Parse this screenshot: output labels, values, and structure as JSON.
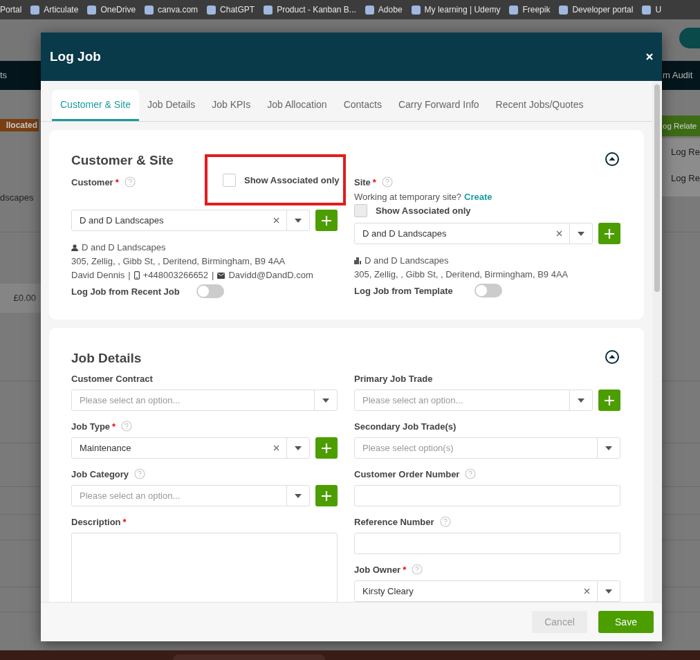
{
  "bookmarks": [
    {
      "label": "Portal",
      "icon": false
    },
    {
      "label": "Articulate",
      "icon": true
    },
    {
      "label": "OneDrive",
      "icon": true
    },
    {
      "label": "canva.com",
      "icon": true
    },
    {
      "label": "ChatGPT",
      "icon": true
    },
    {
      "label": "Product - Kanban B...",
      "icon": true
    },
    {
      "label": "Adobe",
      "icon": true
    },
    {
      "label": "My learning | Udemy",
      "icon": true
    },
    {
      "label": "Freepik",
      "icon": true
    },
    {
      "label": "Developer portal",
      "icon": true
    },
    {
      "label": "U",
      "icon": true
    }
  ],
  "background": {
    "nav_left": "ts",
    "nav_right": "m Audit",
    "status_badge": "llocated",
    "customer_text": "dscapes",
    "amount": "£0.00",
    "action_button": "og Relate",
    "menu_items": [
      "Log Re",
      "Log Re"
    ]
  },
  "dialog": {
    "title": "Log Job",
    "tabs": [
      {
        "label": "Customer & Site",
        "selected": true
      },
      {
        "label": "Job Details",
        "selected": false
      },
      {
        "label": "Job KPIs",
        "selected": false
      },
      {
        "label": "Job Allocation",
        "selected": false
      },
      {
        "label": "Contacts",
        "selected": false
      },
      {
        "label": "Carry Forward Info",
        "selected": false
      },
      {
        "label": "Recent Jobs/Quotes",
        "selected": false
      }
    ],
    "customer_site": {
      "title": "Customer & Site",
      "customer": {
        "label": "Customer",
        "required_mark": "*",
        "help": true,
        "associated": {
          "label": "Show Associated only",
          "checked": false,
          "disabled": false,
          "highlighted": true
        },
        "select": {
          "kind": "select",
          "value": "D and D Landscapes",
          "clearable": true,
          "add_button": true
        },
        "name": "D and D Landscapes",
        "address": "305, Zellig, , Gibb St, , Deritend, Birmingham, B9 4AA",
        "contact": [
          {
            "kind": "text",
            "text": "David Dennis"
          },
          {
            "kind": "text",
            "text": "|"
          },
          {
            "kind": "phone",
            "text": "+448003266652"
          },
          {
            "kind": "text",
            "text": "|"
          },
          {
            "kind": "email",
            "text": "Davidd@DandD.com"
          }
        ],
        "toggle": {
          "label": "Log Job from Recent Job",
          "on": false
        }
      },
      "site": {
        "label": "Site",
        "required_mark": "*",
        "help": true,
        "temp_prompt": "Working at temporary site?",
        "create_link": "Create",
        "associated": {
          "label": "Show Associated only",
          "checked": false,
          "disabled": true,
          "highlighted": false
        },
        "select": {
          "kind": "select",
          "value": "D and D Landscapes",
          "clearable": true,
          "add_button": true
        },
        "name": "D and D Landscapes",
        "address": "305, Zellig, , Gibb St, , Deritend, Birmingham, B9 4AA",
        "toggle": {
          "label": "Log Job from Template",
          "on": false
        }
      }
    },
    "job_details": {
      "title": "Job Details",
      "left": [
        {
          "kind": "select",
          "label": "Customer Contract",
          "help": false,
          "placeholder": "Please select an option...",
          "clearable": false,
          "add_button": false
        },
        {
          "kind": "select",
          "label": "Job Type",
          "required_mark": "*",
          "help": true,
          "value": "Maintenance",
          "clearable": true,
          "add_button": true
        },
        {
          "kind": "select",
          "label": "Job Category",
          "help": true,
          "placeholder": "Please select an option...",
          "clearable": false,
          "add_button": true
        },
        {
          "kind": "textarea",
          "label": "Description",
          "required_mark": "*",
          "help": false
        }
      ],
      "right": [
        {
          "kind": "select",
          "label": "Primary Job Trade",
          "help": false,
          "placeholder": "Please select an option...",
          "clearable": false,
          "add_button": true
        },
        {
          "kind": "select",
          "label": "Secondary Job Trade(s)",
          "help": false,
          "placeholder": "Please select option(s)",
          "clearable": false,
          "add_button": false
        },
        {
          "kind": "text",
          "label": "Customer Order Number",
          "help": true
        },
        {
          "kind": "text",
          "label": "Reference Number",
          "help": true
        },
        {
          "kind": "select",
          "label": "Job Owner",
          "required_mark": "*",
          "help": true,
          "value": "Kirsty Cleary",
          "clearable": true,
          "add_button": false
        }
      ]
    },
    "buttons": [
      {
        "label": "Cancel",
        "kind": "secondary"
      },
      {
        "label": "Save",
        "kind": "primary"
      }
    ]
  }
}
